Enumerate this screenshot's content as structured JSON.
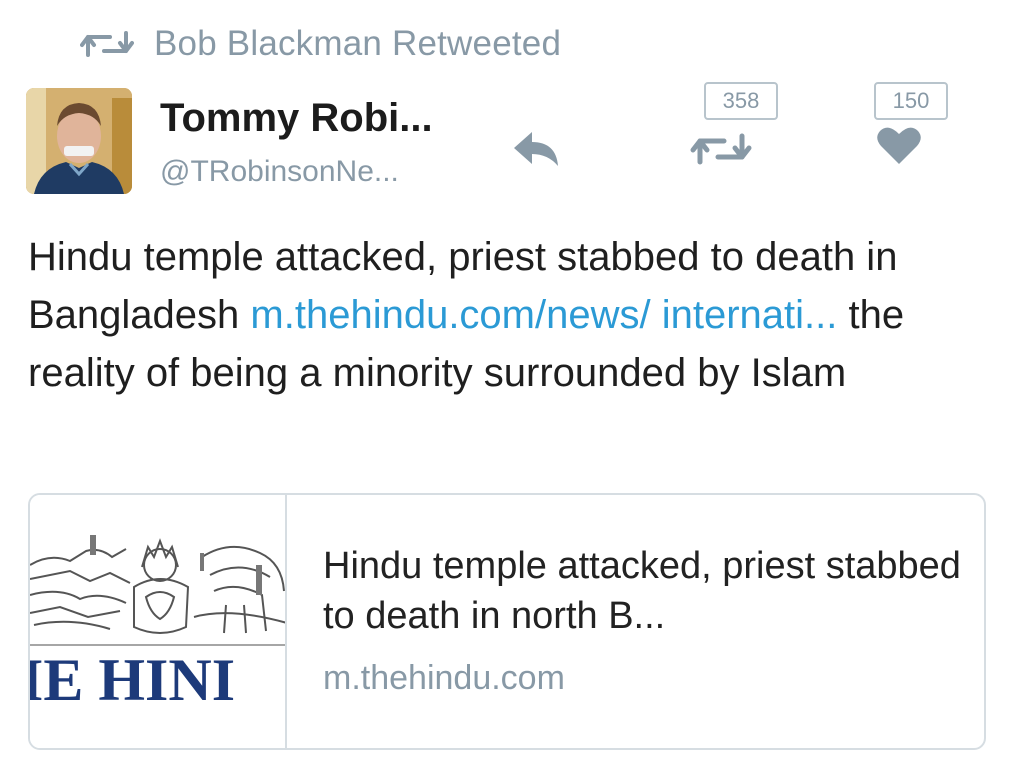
{
  "retweet_header": {
    "icon": "retweet-icon",
    "text": "Bob Blackman Retweeted"
  },
  "tweet": {
    "author_name": "Tommy Robi...",
    "author_handle": "@TRobinsonNe...",
    "avatar": "avatar-photo",
    "text_part1": "Hindu temple attacked, priest stabbed to death in Bangladesh ",
    "link_text": "m.thehindu.com/news/ internati...",
    "text_part2": " the reality of being a minority surrounded by Islam"
  },
  "actions": {
    "reply_icon": "reply-icon",
    "retweet_icon": "retweet-icon",
    "retweet_count": "358",
    "like_icon": "heart-icon",
    "like_count": "150"
  },
  "card": {
    "thumbnail_icon": "the-hindu-masthead",
    "thumbnail_text": "IE HINI",
    "title": "Hindu temple attacked, priest stabbed to death in north B...",
    "domain": "m.thehindu.com"
  },
  "colors": {
    "muted": "#8899a6",
    "link": "#2b9ad5",
    "border": "#d6dde2"
  }
}
